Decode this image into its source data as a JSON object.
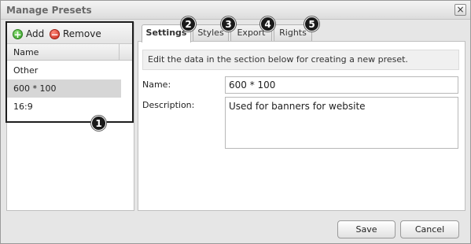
{
  "window": {
    "title": "Manage Presets",
    "close_glyph": "×"
  },
  "left": {
    "toolbar": {
      "add_label": "Add",
      "remove_label": "Remove",
      "add_icon": "plus-circle-icon",
      "remove_icon": "minus-circle-icon"
    },
    "list_header": "Name",
    "items": [
      {
        "label": "Other"
      },
      {
        "label": "600 * 100",
        "selected": true
      },
      {
        "label": "16:9"
      }
    ]
  },
  "tabs": [
    {
      "label": "Settings",
      "active": true
    },
    {
      "label": "Styles"
    },
    {
      "label": "Export"
    },
    {
      "label": "Rights"
    }
  ],
  "settings": {
    "info": "Edit the data in the section below for creating a new preset.",
    "name_label": "Name:",
    "name_value": "600 * 100",
    "desc_label": "Description:",
    "desc_value": "Used for banners for website"
  },
  "footer": {
    "save_label": "Save",
    "cancel_label": "Cancel"
  },
  "callouts": [
    "1",
    "2",
    "3",
    "4",
    "5"
  ]
}
